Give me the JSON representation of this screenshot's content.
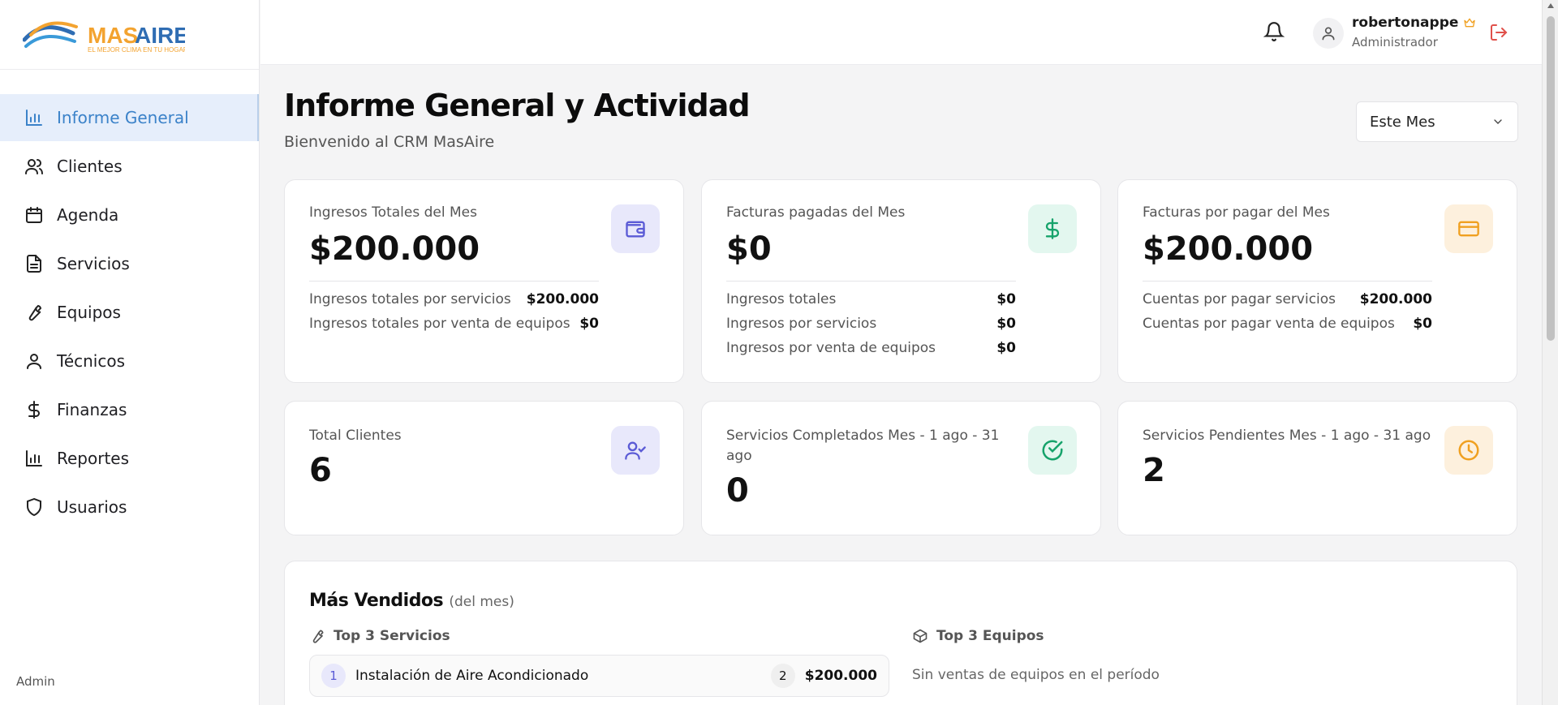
{
  "brand": {
    "name": "MASAIRE",
    "tagline": "EL MEJOR CLIMA EN TU HOGAR"
  },
  "sidebar": {
    "items": [
      {
        "label": "Informe General",
        "icon": "bar-chart-icon",
        "active": true
      },
      {
        "label": "Clientes",
        "icon": "users-icon"
      },
      {
        "label": "Agenda",
        "icon": "calendar-icon"
      },
      {
        "label": "Servicios",
        "icon": "document-icon"
      },
      {
        "label": "Equipos",
        "icon": "wrench-icon"
      },
      {
        "label": "Técnicos",
        "icon": "user-icon"
      },
      {
        "label": "Finanzas",
        "icon": "dollar-icon"
      },
      {
        "label": "Reportes",
        "icon": "bar-chart-icon"
      },
      {
        "label": "Usuarios",
        "icon": "shield-icon"
      }
    ],
    "footer": "Admin"
  },
  "topbar": {
    "user_name": "robertonappe",
    "user_role": "Administrador"
  },
  "header": {
    "title": "Informe General y Actividad",
    "subtitle": "Bienvenido al CRM MasAire",
    "period": "Este Mes"
  },
  "cards": {
    "ingresos": {
      "label": "Ingresos Totales del Mes",
      "value": "$200.000",
      "rows": [
        {
          "label": "Ingresos totales por servicios",
          "value": "$200.000"
        },
        {
          "label": "Ingresos totales por venta de equipos",
          "value": "$0"
        }
      ]
    },
    "pagadas": {
      "label": "Facturas pagadas del Mes",
      "value": "$0",
      "rows": [
        {
          "label": "Ingresos totales",
          "value": "$0"
        },
        {
          "label": "Ingresos por servicios",
          "value": "$0"
        },
        {
          "label": "Ingresos por venta de equipos",
          "value": "$0"
        }
      ]
    },
    "por_pagar": {
      "label": "Facturas por pagar del Mes",
      "value": "$200.000",
      "rows": [
        {
          "label": "Cuentas por pagar servicios",
          "value": "$200.000"
        },
        {
          "label": "Cuentas por pagar venta de equipos",
          "value": "$0"
        }
      ]
    },
    "clientes": {
      "label": "Total Clientes",
      "value": "6"
    },
    "completados": {
      "label": "Servicios Completados Mes - 1 ago - 31 ago",
      "value": "0"
    },
    "pendientes": {
      "label": "Servicios Pendientes Mes - 1 ago - 31 ago",
      "value": "2"
    }
  },
  "sales": {
    "title": "Más Vendidos",
    "subtitle": "(del mes)",
    "services_head": "Top 3 Servicios",
    "equipment_head": "Top 3 Equipos",
    "services": [
      {
        "rank": "1",
        "name": "Instalación de Aire Acondicionado",
        "qty": "2",
        "amount": "$200.000"
      }
    ],
    "equipment_empty": "Sin ventas de equipos en el período"
  },
  "colors": {
    "accent": "#3b82c9",
    "active_bg": "#e6eefb",
    "purple": "#5b5bd6",
    "green": "#16a36b",
    "orange": "#f0a020",
    "danger": "#e0504a"
  }
}
